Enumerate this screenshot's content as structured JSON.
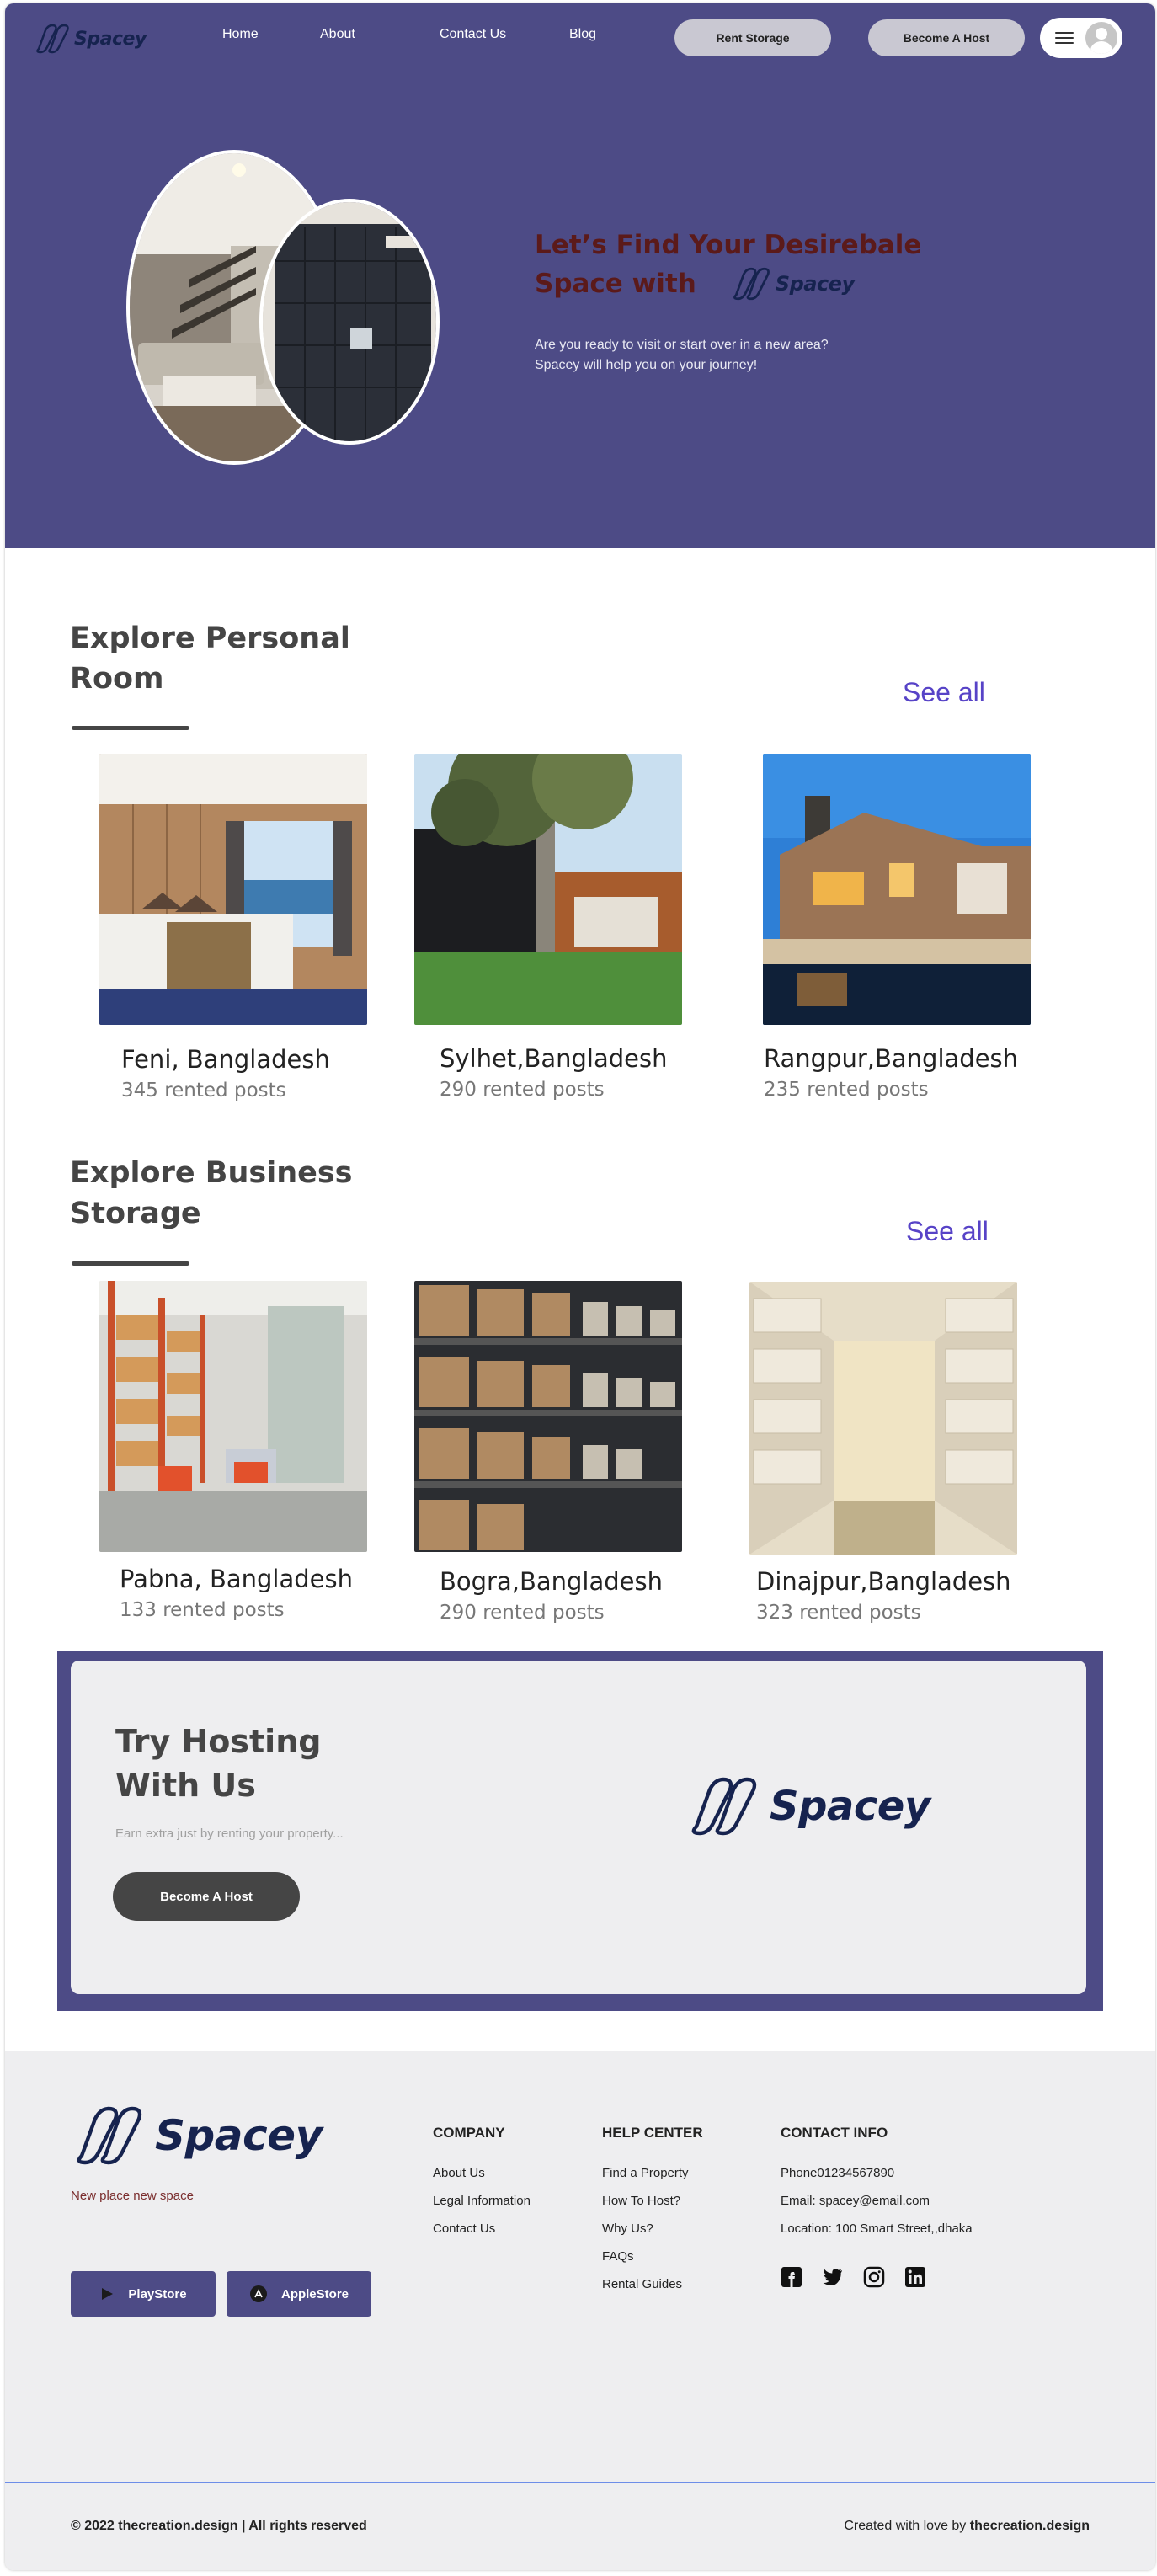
{
  "header": {
    "logo_text": "Spacey",
    "nav": [
      "Home",
      "About",
      "Contact Us",
      "Blog"
    ],
    "rent_storage": "Rent Storage",
    "become_host": "Become A Host"
  },
  "hero": {
    "title_line1": "Let’s Find Your Desirebale",
    "title_line2": "Space with",
    "logo_text": "Spacey",
    "subtitle_line1": "Are you ready to visit or start over in a new area?",
    "subtitle_line2": "Spacey will help you on your journey!"
  },
  "personal": {
    "title_line1": "Explore Personal",
    "title_line2": "Room",
    "see_all": "See all",
    "cards": [
      {
        "city": "Feni, Bangladesh",
        "posts": "345 rented posts"
      },
      {
        "city": "Sylhet,Bangladesh",
        "posts": "290 rented posts"
      },
      {
        "city": "Rangpur,Bangladesh",
        "posts": "235 rented posts"
      }
    ]
  },
  "business": {
    "title_line1": "Explore Business",
    "title_line2": "Storage",
    "see_all": "See all",
    "cards": [
      {
        "city": "Pabna, Bangladesh",
        "posts": "133 rented posts"
      },
      {
        "city": "Bogra,Bangladesh",
        "posts": "290 rented posts"
      },
      {
        "city": "Dinajpur,Bangladesh",
        "posts": "323 rented posts"
      }
    ]
  },
  "cta": {
    "title_line1": "Try Hosting",
    "title_line2": "With Us",
    "subtitle": "Earn extra just by renting your property...",
    "button": "Become A Host",
    "logo_text": "Spacey"
  },
  "footer": {
    "logo_text": "Spacey",
    "tagline": "New place new  space",
    "playstore": "PlayStore",
    "applestore": "AppleStore",
    "company": {
      "heading": "COMPANY",
      "links": [
        "About Us",
        "Legal Information",
        "Contact Us"
      ]
    },
    "help": {
      "heading": "HELP CENTER",
      "links": [
        "Find a Property",
        "How To Host?",
        "Why Us?",
        "FAQs",
        "Rental Guides"
      ]
    },
    "contact": {
      "heading": "CONTACT INFO",
      "phone": "Phone01234567890",
      "email": "Email: spacey@email.com",
      "location": "Location: 100 Smart Street,,dhaka"
    },
    "social_icons": [
      "facebook-icon",
      "twitter-icon",
      "instagram-icon",
      "linkedin-icon"
    ],
    "copyright": "© 2022 thecreation.design | All rights reserved",
    "credit_prefix": "Created with love by ",
    "credit_brand": "thecreation.design"
  },
  "colors": {
    "brand": "#4d4b86",
    "accent_link": "#5743c7",
    "hero_title": "#5b1a1a",
    "logo_navy": "#16234f"
  }
}
